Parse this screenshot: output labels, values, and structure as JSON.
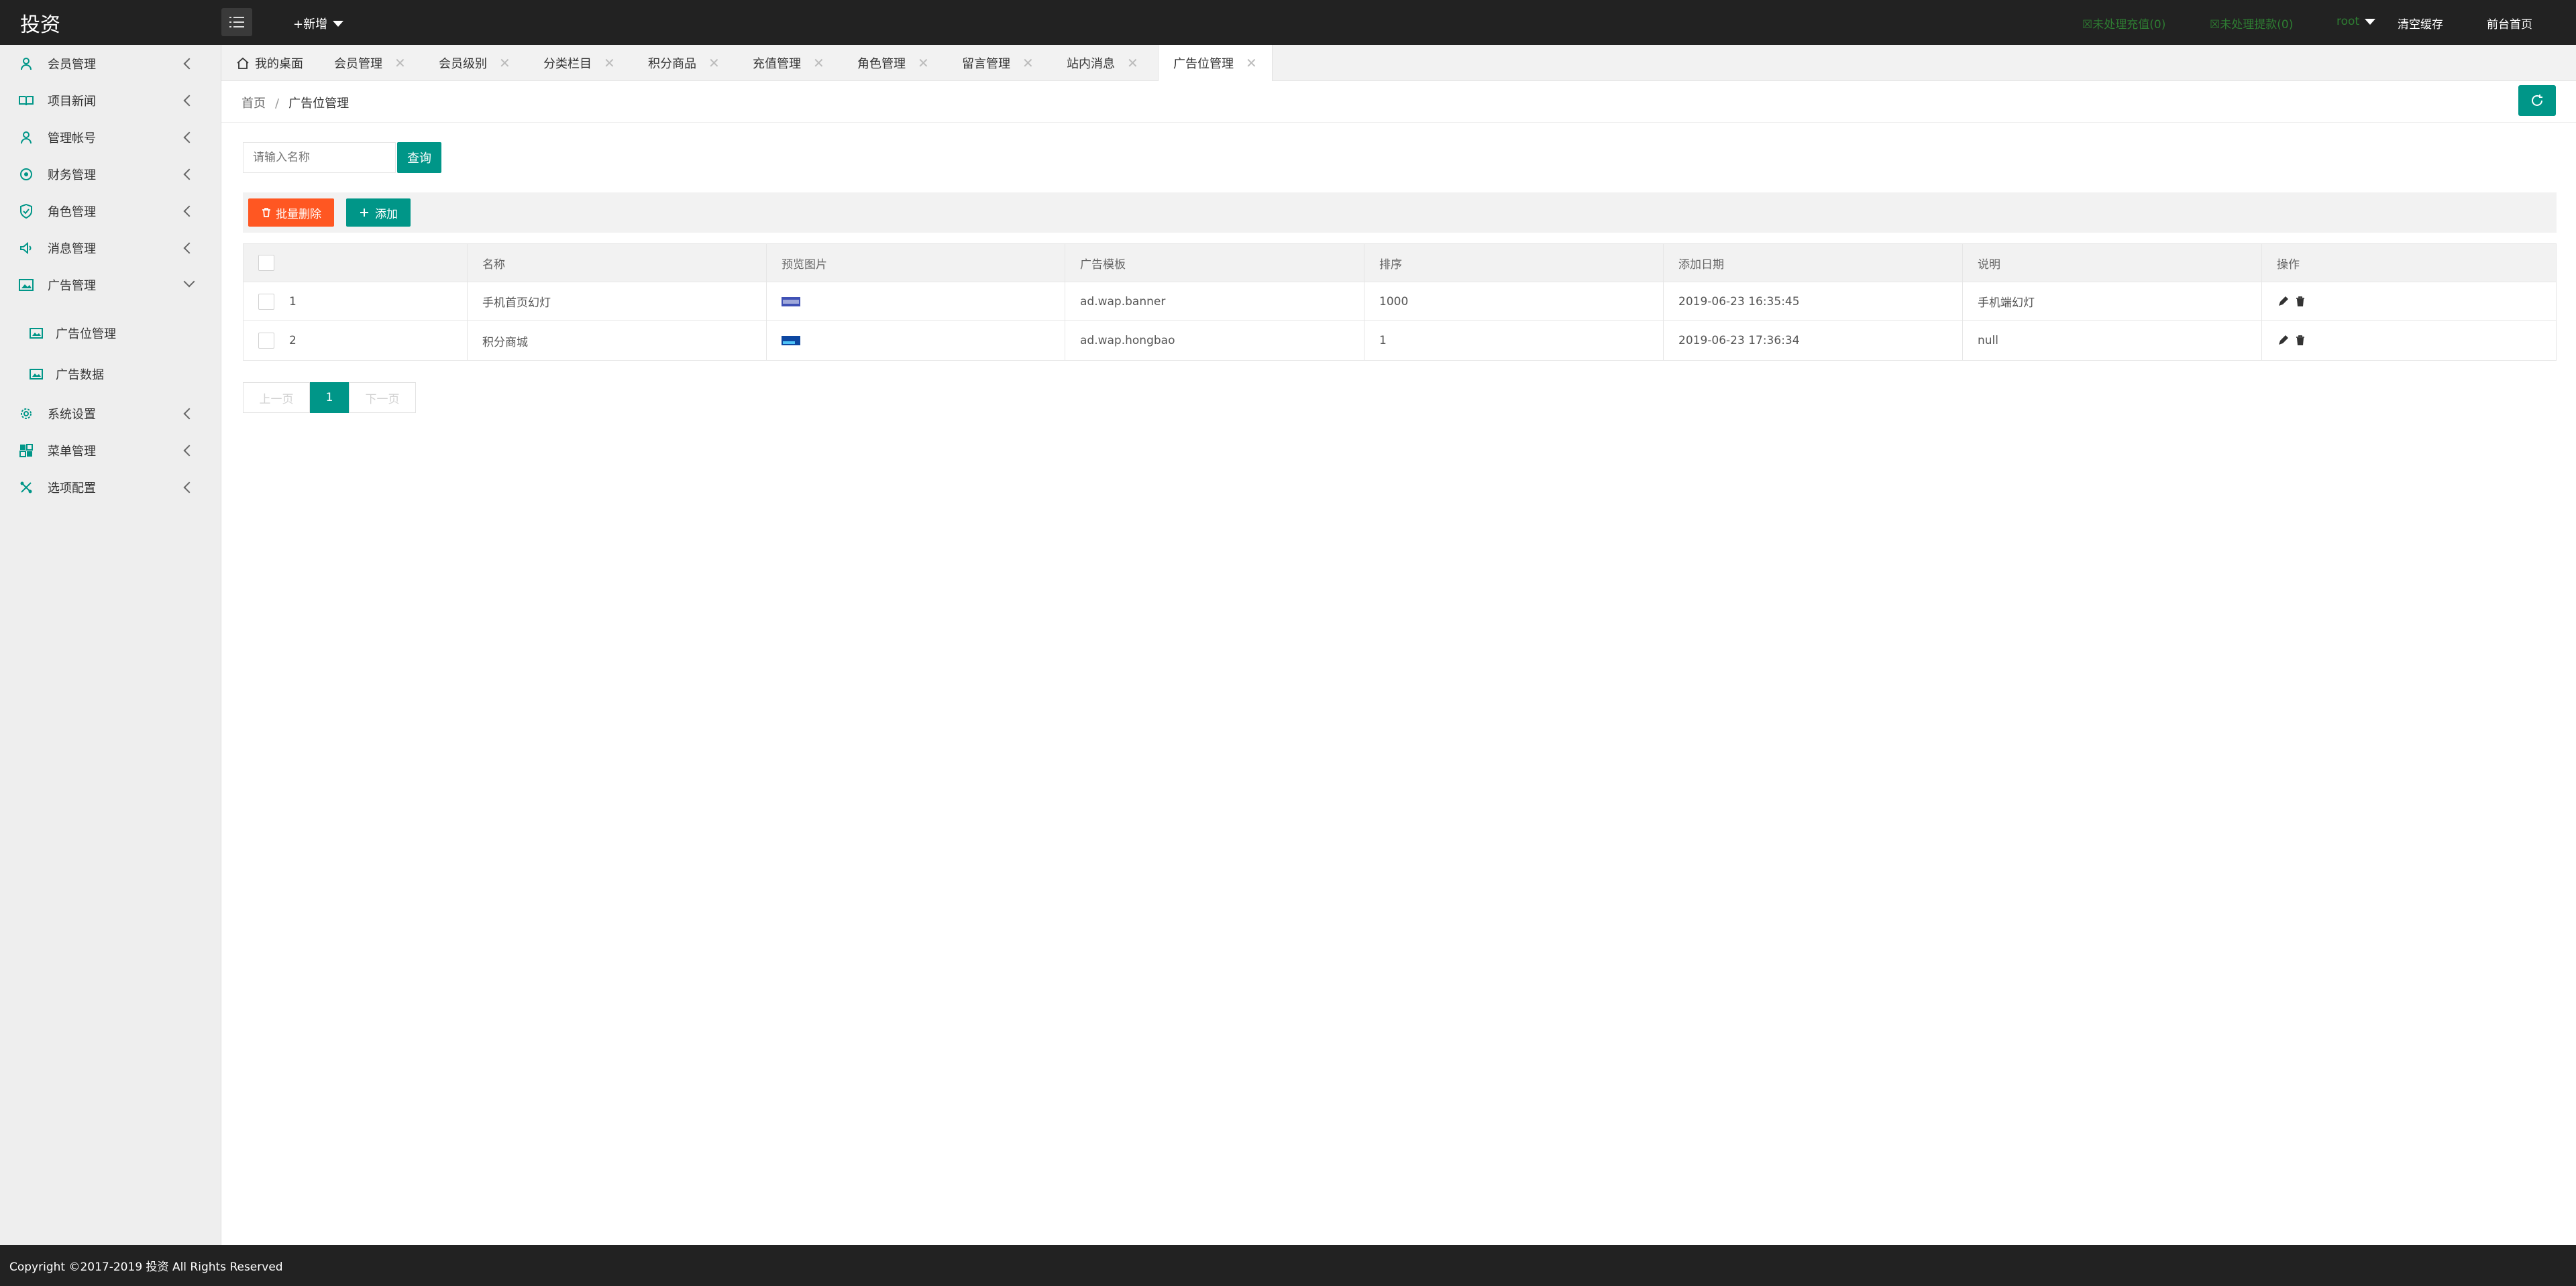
{
  "app": {
    "logo": "投资"
  },
  "header": {
    "add_new": "+新增",
    "pending_recharge": "☒未处理充值(0)",
    "pending_withdraw": "☒未处理提款(0)",
    "user": "root",
    "clear_cache": "清空缓存",
    "front_home": "前台首页"
  },
  "sidebar": {
    "items": [
      {
        "label": "会员管理",
        "icon": "user-icon"
      },
      {
        "label": "项目新闻",
        "icon": "book-icon"
      },
      {
        "label": "管理帐号",
        "icon": "admin-icon"
      },
      {
        "label": "财务管理",
        "icon": "finance-icon"
      },
      {
        "label": "角色管理",
        "icon": "shield-icon"
      },
      {
        "label": "消息管理",
        "icon": "message-icon"
      },
      {
        "label": "广告管理",
        "icon": "image-icon"
      },
      {
        "label": "系统设置",
        "icon": "gear-icon"
      },
      {
        "label": "菜单管理",
        "icon": "menu-icon"
      },
      {
        "label": "选项配置",
        "icon": "config-icon"
      }
    ],
    "sub_items": [
      {
        "label": "广告位管理",
        "icon": "image-icon"
      },
      {
        "label": "广告数据",
        "icon": "image-icon"
      }
    ]
  },
  "tabs": [
    {
      "label": "我的桌面"
    },
    {
      "label": "会员管理"
    },
    {
      "label": "会员级别"
    },
    {
      "label": "分类栏目"
    },
    {
      "label": "积分商品"
    },
    {
      "label": "充值管理"
    },
    {
      "label": "角色管理"
    },
    {
      "label": "留言管理"
    },
    {
      "label": "站内消息"
    },
    {
      "label": "广告位管理"
    }
  ],
  "breadcrumb": {
    "home": "首页",
    "sep": "/",
    "current": "广告位管理"
  },
  "search": {
    "placeholder": "请输入名称",
    "button": "查询"
  },
  "toolbar": {
    "batch_delete": "批量删除",
    "add": "添加"
  },
  "table": {
    "headers": [
      "",
      "名称",
      "预览图片",
      "广告模板",
      "排序",
      "添加日期",
      "说明",
      "操作"
    ],
    "rows": [
      {
        "id": "1",
        "name": "手机首页幻灯",
        "template": "ad.wap.banner",
        "sort": "1000",
        "date": "2019-06-23 16:35:45",
        "desc": "手机端幻灯"
      },
      {
        "id": "2",
        "name": "积分商城",
        "template": "ad.wap.hongbao",
        "sort": "1",
        "date": "2019-06-23 17:36:34",
        "desc": "null"
      }
    ]
  },
  "pager": {
    "prev": "上一页",
    "current": "1",
    "next": "下一页"
  },
  "footer": {
    "copyright": "Copyright ©2017-2019 投资 All Rights Reserved"
  },
  "colors": {
    "accent": "#009688",
    "danger": "#ff5722",
    "header_bg": "#222222",
    "sidebar_bg": "#eeeeee",
    "pending_green": "#2e7d32"
  }
}
